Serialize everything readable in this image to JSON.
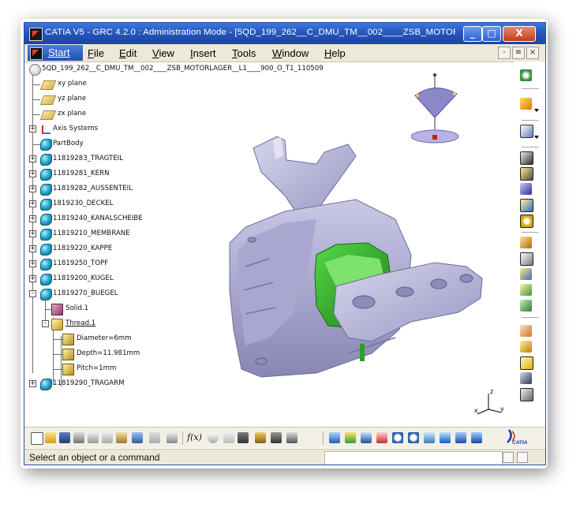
{
  "window": {
    "title": "CATIA V5 - GRC 4.2.0 : Administration Mode - [5QD_199_262__C_DMU_TM__002____ZSB_MOTORLA...",
    "btn_minimize": "_",
    "btn_restore": "□",
    "btn_close": "X"
  },
  "menu": {
    "start": "Start",
    "items": [
      "File",
      "Edit",
      "View",
      "Insert",
      "Tools",
      "Window",
      "Help"
    ],
    "mdi_minimize": "-",
    "mdi_restore": "≡",
    "mdi_close": "×"
  },
  "tree": {
    "root": "5QD_199_262__C_DMU_TM__002____ZSB_MOTORLAGER__L1____900_O_T1_110509",
    "nodes": [
      {
        "label": "xy plane",
        "icon": "plane-icon"
      },
      {
        "label": "yz plane",
        "icon": "plane-icon"
      },
      {
        "label": "zx plane",
        "icon": "plane-icon"
      },
      {
        "label": "Axis Systems",
        "icon": "axis-system-icon"
      },
      {
        "label": "PartBody",
        "icon": "part-body-icon"
      },
      {
        "label": "11819283_TRAGTEIL",
        "icon": "part-icon"
      },
      {
        "label": "11819281_KERN",
        "icon": "part-icon"
      },
      {
        "label": "11819282_AUSSENTEIL",
        "icon": "part-icon"
      },
      {
        "label": "1819230_DECKEL",
        "icon": "part-icon"
      },
      {
        "label": "11819240_KANALSCHEIBE",
        "icon": "part-icon"
      },
      {
        "label": "11819210_MEMBRANE",
        "icon": "part-icon"
      },
      {
        "label": "11819220_KAPPE",
        "icon": "part-icon"
      },
      {
        "label": "11819250_TOPF",
        "icon": "part-icon"
      },
      {
        "label": "11819200_KUGEL",
        "icon": "part-icon"
      },
      {
        "label": "11819270_BUEGEL",
        "icon": "part-icon"
      },
      {
        "label": "Solid.1",
        "icon": "solid-icon"
      },
      {
        "label": "Thread.1",
        "icon": "thread-icon"
      },
      {
        "label": "Diameter=6mm",
        "icon": "parameter-icon"
      },
      {
        "label": "Depth=11.981mm",
        "icon": "parameter-icon"
      },
      {
        "label": "Pitch=1mm",
        "icon": "parameter-icon"
      },
      {
        "label": "11819290_TRAGARM",
        "icon": "part-icon"
      }
    ]
  },
  "triad": {
    "z": "z",
    "x": "x",
    "y": "y"
  },
  "bottom_toolbar": {
    "formula_label": "f(x)"
  },
  "status": {
    "message": "Select an object or a command",
    "command_input": ""
  },
  "brand": {
    "logo_text": "CATIA"
  },
  "colors": {
    "title_bar": "#2252b8",
    "menu_bg": "#ece9d8",
    "model_gray": "#b7b5d6",
    "model_green": "#27b01f",
    "compass_purple": "#8c87c9"
  }
}
